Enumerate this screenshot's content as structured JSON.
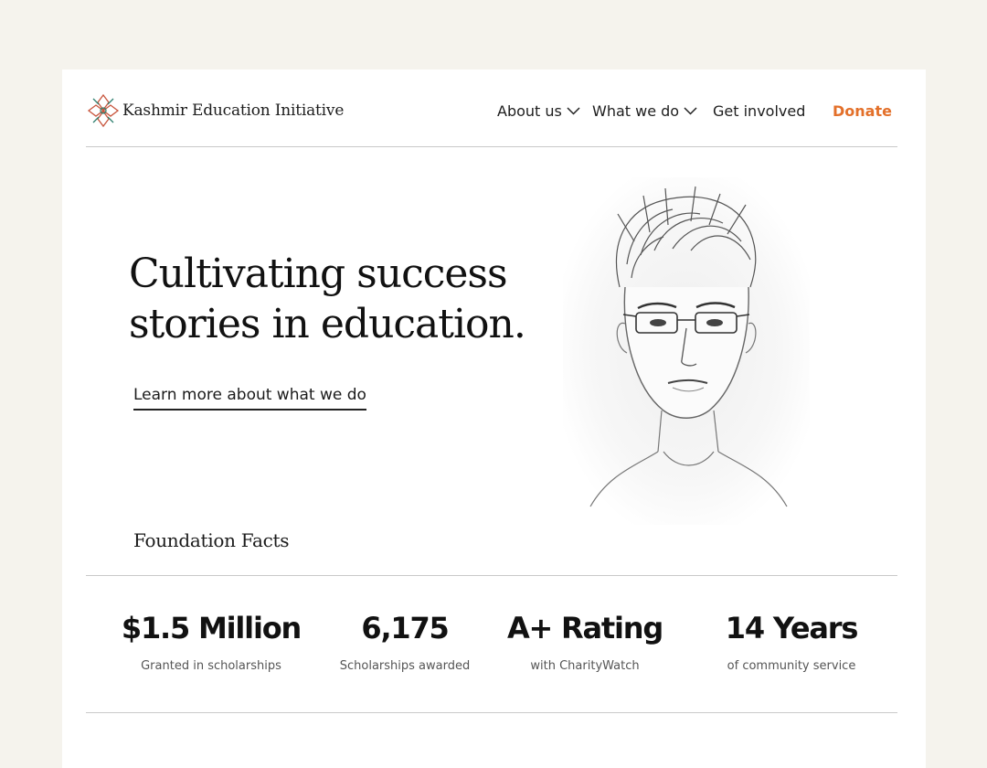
{
  "brand": {
    "name": "Kashmir Education Initiative",
    "logo_icon": "kashmiri-flower-icon"
  },
  "nav": {
    "items": [
      {
        "label": "About us",
        "has_dropdown": true
      },
      {
        "label": "What we do",
        "has_dropdown": true
      },
      {
        "label": "Get involved",
        "has_dropdown": false
      }
    ],
    "donate_label": "Donate"
  },
  "hero": {
    "title": "Cultivating success\nstories in education.",
    "link_label": "Learn more about what we do",
    "image": "pencil-sketch-portrait"
  },
  "facts": {
    "title": "Foundation Facts",
    "items": [
      {
        "value": "$1.5 Million",
        "label": "Granted in scholarships"
      },
      {
        "value": "6,175",
        "label": "Scholarships awarded"
      },
      {
        "value": "A+ Rating",
        "label": "with CharityWatch"
      },
      {
        "value": "14 Years",
        "label": "of community service"
      }
    ]
  },
  "colors": {
    "accent": "#e3702a",
    "background": "#f5f3ed",
    "card": "#ffffff",
    "rule": "#c9c9c9"
  }
}
